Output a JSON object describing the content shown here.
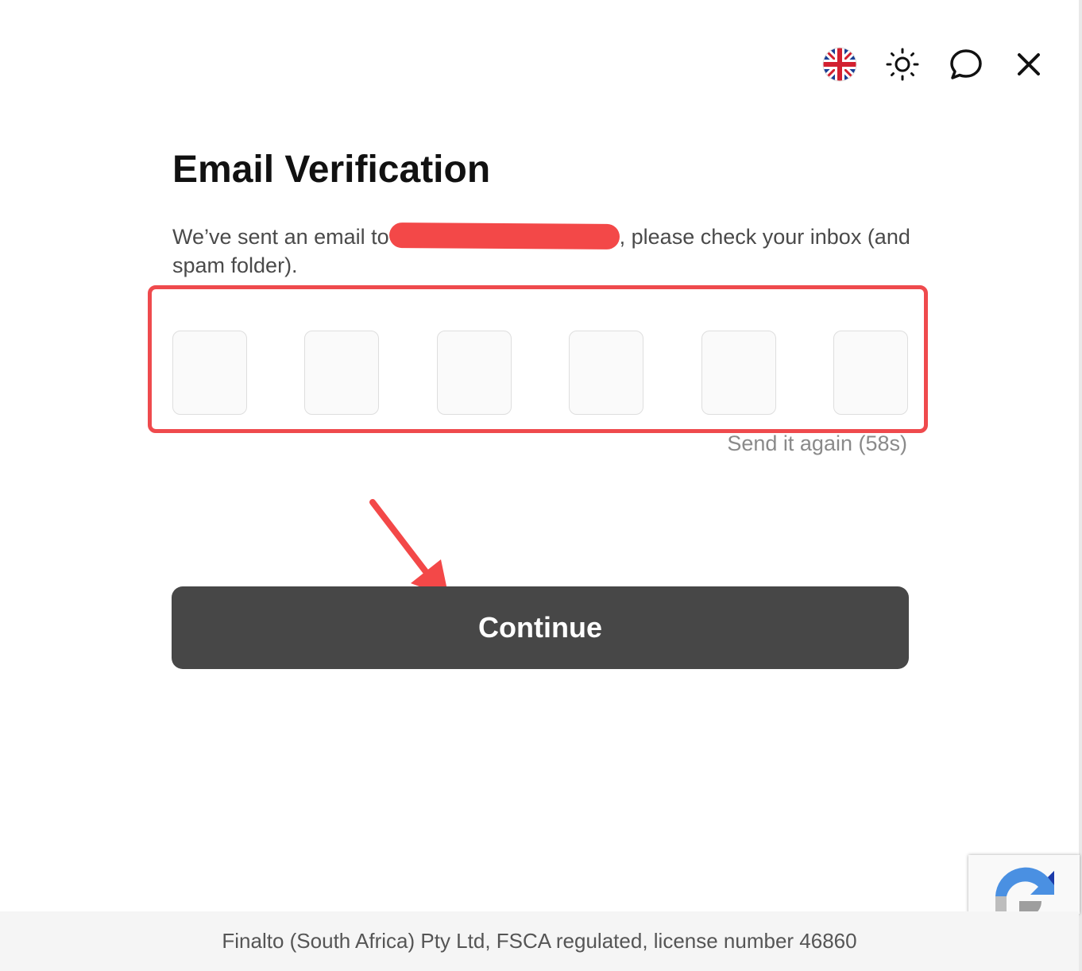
{
  "toolbar": {
    "language_icon": "uk-flag-icon",
    "theme_icon": "sun-icon",
    "chat_icon": "chat-bubble-icon",
    "close_icon": "close-icon"
  },
  "verification": {
    "title": "Email Verification",
    "description_prefix": "We’ve sent an email to",
    "description_suffix": ", please check your inbox (and spam folder).",
    "code_digits": [
      "",
      "",
      "",
      "",
      "",
      ""
    ],
    "resend_label": "Send it again (58s)"
  },
  "actions": {
    "continue_label": "Continue"
  },
  "footer": {
    "legal_text": "Finalto (South Africa) Pty Ltd, FSCA regulated, license number 46860"
  },
  "colors": {
    "annotation_red": "#ef4a4d",
    "button_bg": "#474747",
    "title_text": "#111111"
  }
}
